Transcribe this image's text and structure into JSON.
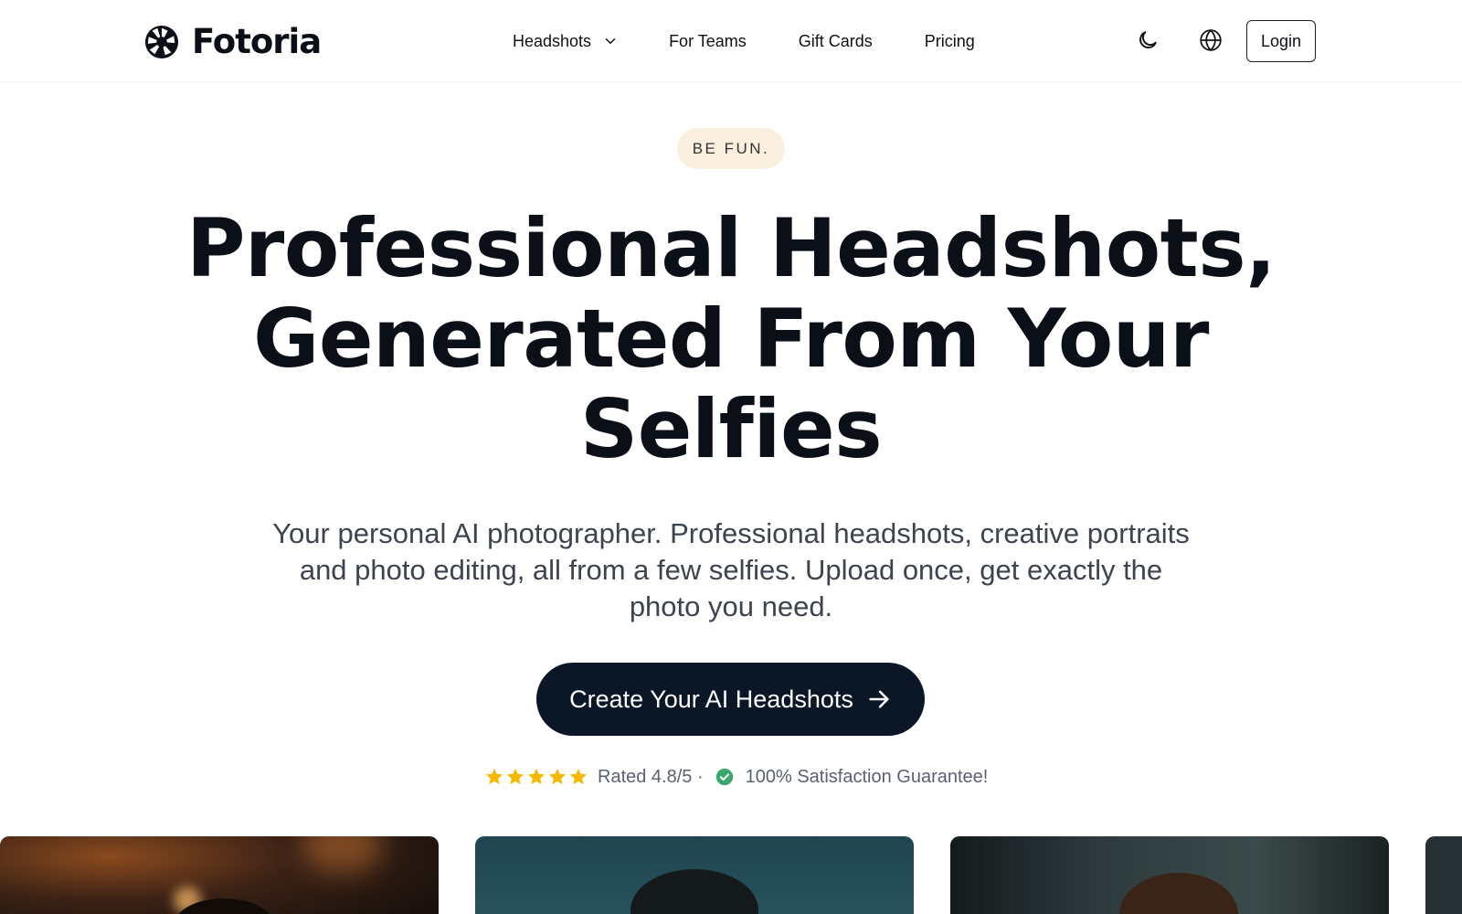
{
  "brand": {
    "name": "Fotoria",
    "logo_icon": "aperture-icon"
  },
  "nav": {
    "items": [
      {
        "label": "Headshots",
        "has_dropdown": true
      },
      {
        "label": "For Teams"
      },
      {
        "label": "Gift Cards"
      },
      {
        "label": "Pricing"
      }
    ],
    "theme_icon": "moon-icon",
    "language_icon": "globe-icon",
    "login_label": "Login"
  },
  "hero": {
    "tag": "BE FUN.",
    "title_lines": [
      "Professional Headshots,",
      "Generated From Your",
      "Selfies"
    ],
    "subtitle": "Your personal AI photographer. Professional headshots, creative portraits and photo editing, all from a few selfies. Upload once, get exactly the photo you need.",
    "cta_label": "Create Your AI Headshots",
    "cta_icon": "arrow-right-icon"
  },
  "rating": {
    "stars": 5,
    "text": "Rated 4.8/5 ·",
    "guarantee": "100% Satisfaction Guarantee!",
    "star_color": "#f5b800",
    "check_color": "#3aa76d"
  },
  "colors": {
    "cta_background": "#0b1727",
    "tag_background": "#fbf0df",
    "text_primary": "#0b0f17"
  }
}
